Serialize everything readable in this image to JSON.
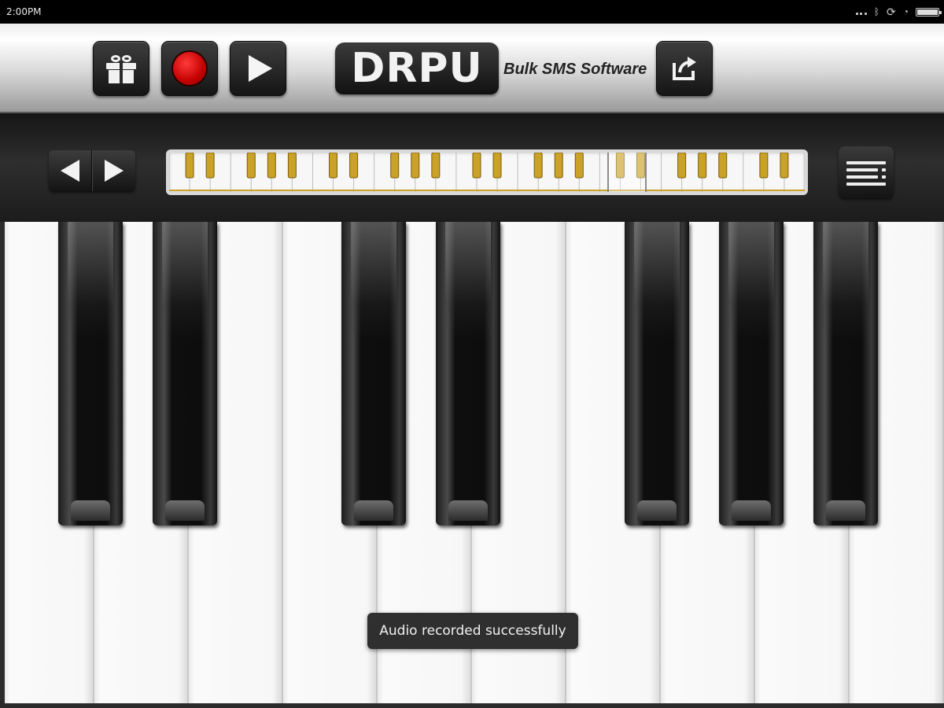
{
  "status_bar": {
    "time": "2:00PM",
    "icons": [
      "more-dots-icon",
      "bluetooth-icon",
      "sync-icon",
      "wifi-icon",
      "battery-icon"
    ]
  },
  "toolbar": {
    "buttons": [
      "gift-icon",
      "record-icon",
      "play-icon",
      "share-icon"
    ],
    "logo_text": "DRPU",
    "logo_subtitle": "Bulk SMS Software",
    "colors": {
      "record": "#d10000",
      "button_bg": "#1e1e1e"
    }
  },
  "navigator": {
    "left_arrow": "arrow-left-icon",
    "right_arrow": "arrow-right-icon",
    "menu": "menu-list-icon",
    "mini_keyboard_white_keys": 31,
    "key_color": "#c9a227"
  },
  "piano": {
    "white_key_count": 10,
    "black_key_positions": [
      0,
      1,
      3,
      4,
      6,
      7,
      8
    ]
  },
  "toast": {
    "message": "Audio recorded successfully"
  }
}
